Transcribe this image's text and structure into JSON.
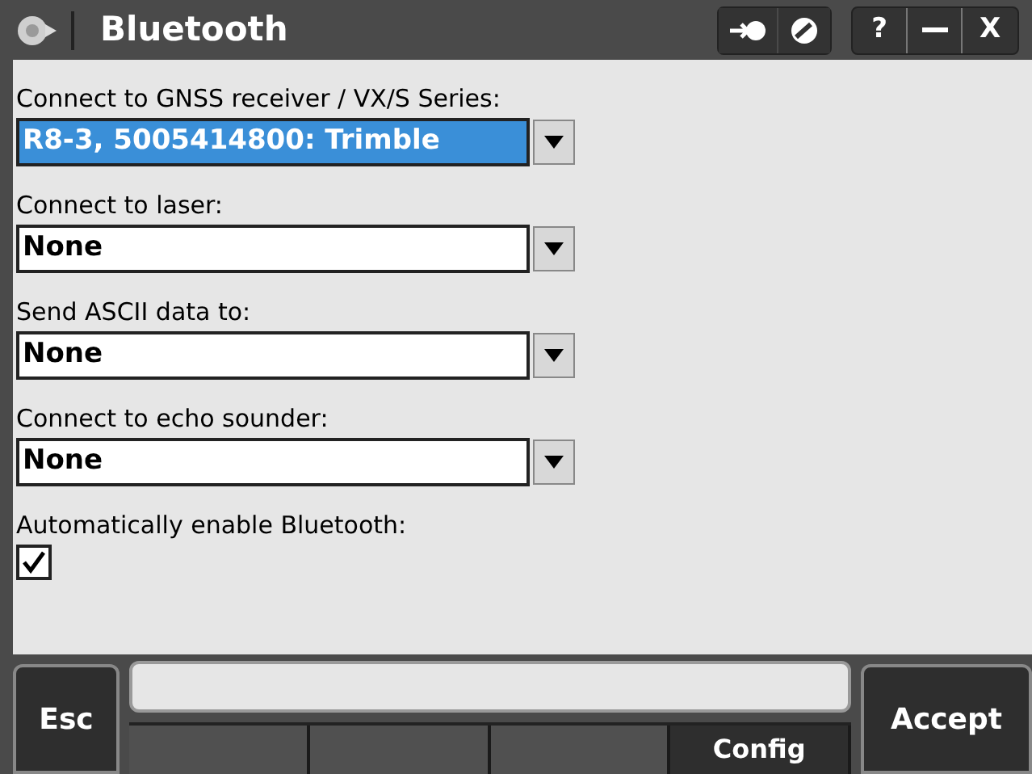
{
  "window": {
    "title": "Bluetooth",
    "help_button": "?",
    "close_button": "X"
  },
  "fields": [
    {
      "label": "Connect to GNSS receiver / VX/S Series:",
      "value": "R8-3, 5005414800: Trimble",
      "selected": true
    },
    {
      "label": "Connect to laser:",
      "value": "None",
      "selected": false
    },
    {
      "label": "Send ASCII data to:",
      "value": "None",
      "selected": false
    },
    {
      "label": "Connect to echo sounder:",
      "value": "None",
      "selected": false
    }
  ],
  "auto_enable": {
    "label": "Automatically enable Bluetooth:",
    "checked": true
  },
  "softkeys": {
    "left": "Esc",
    "right": "Accept",
    "slots": [
      {
        "kind": "blank"
      },
      {
        "kind": "blank"
      },
      {
        "kind": "blank"
      },
      {
        "kind": "key",
        "label": "Config"
      }
    ]
  }
}
